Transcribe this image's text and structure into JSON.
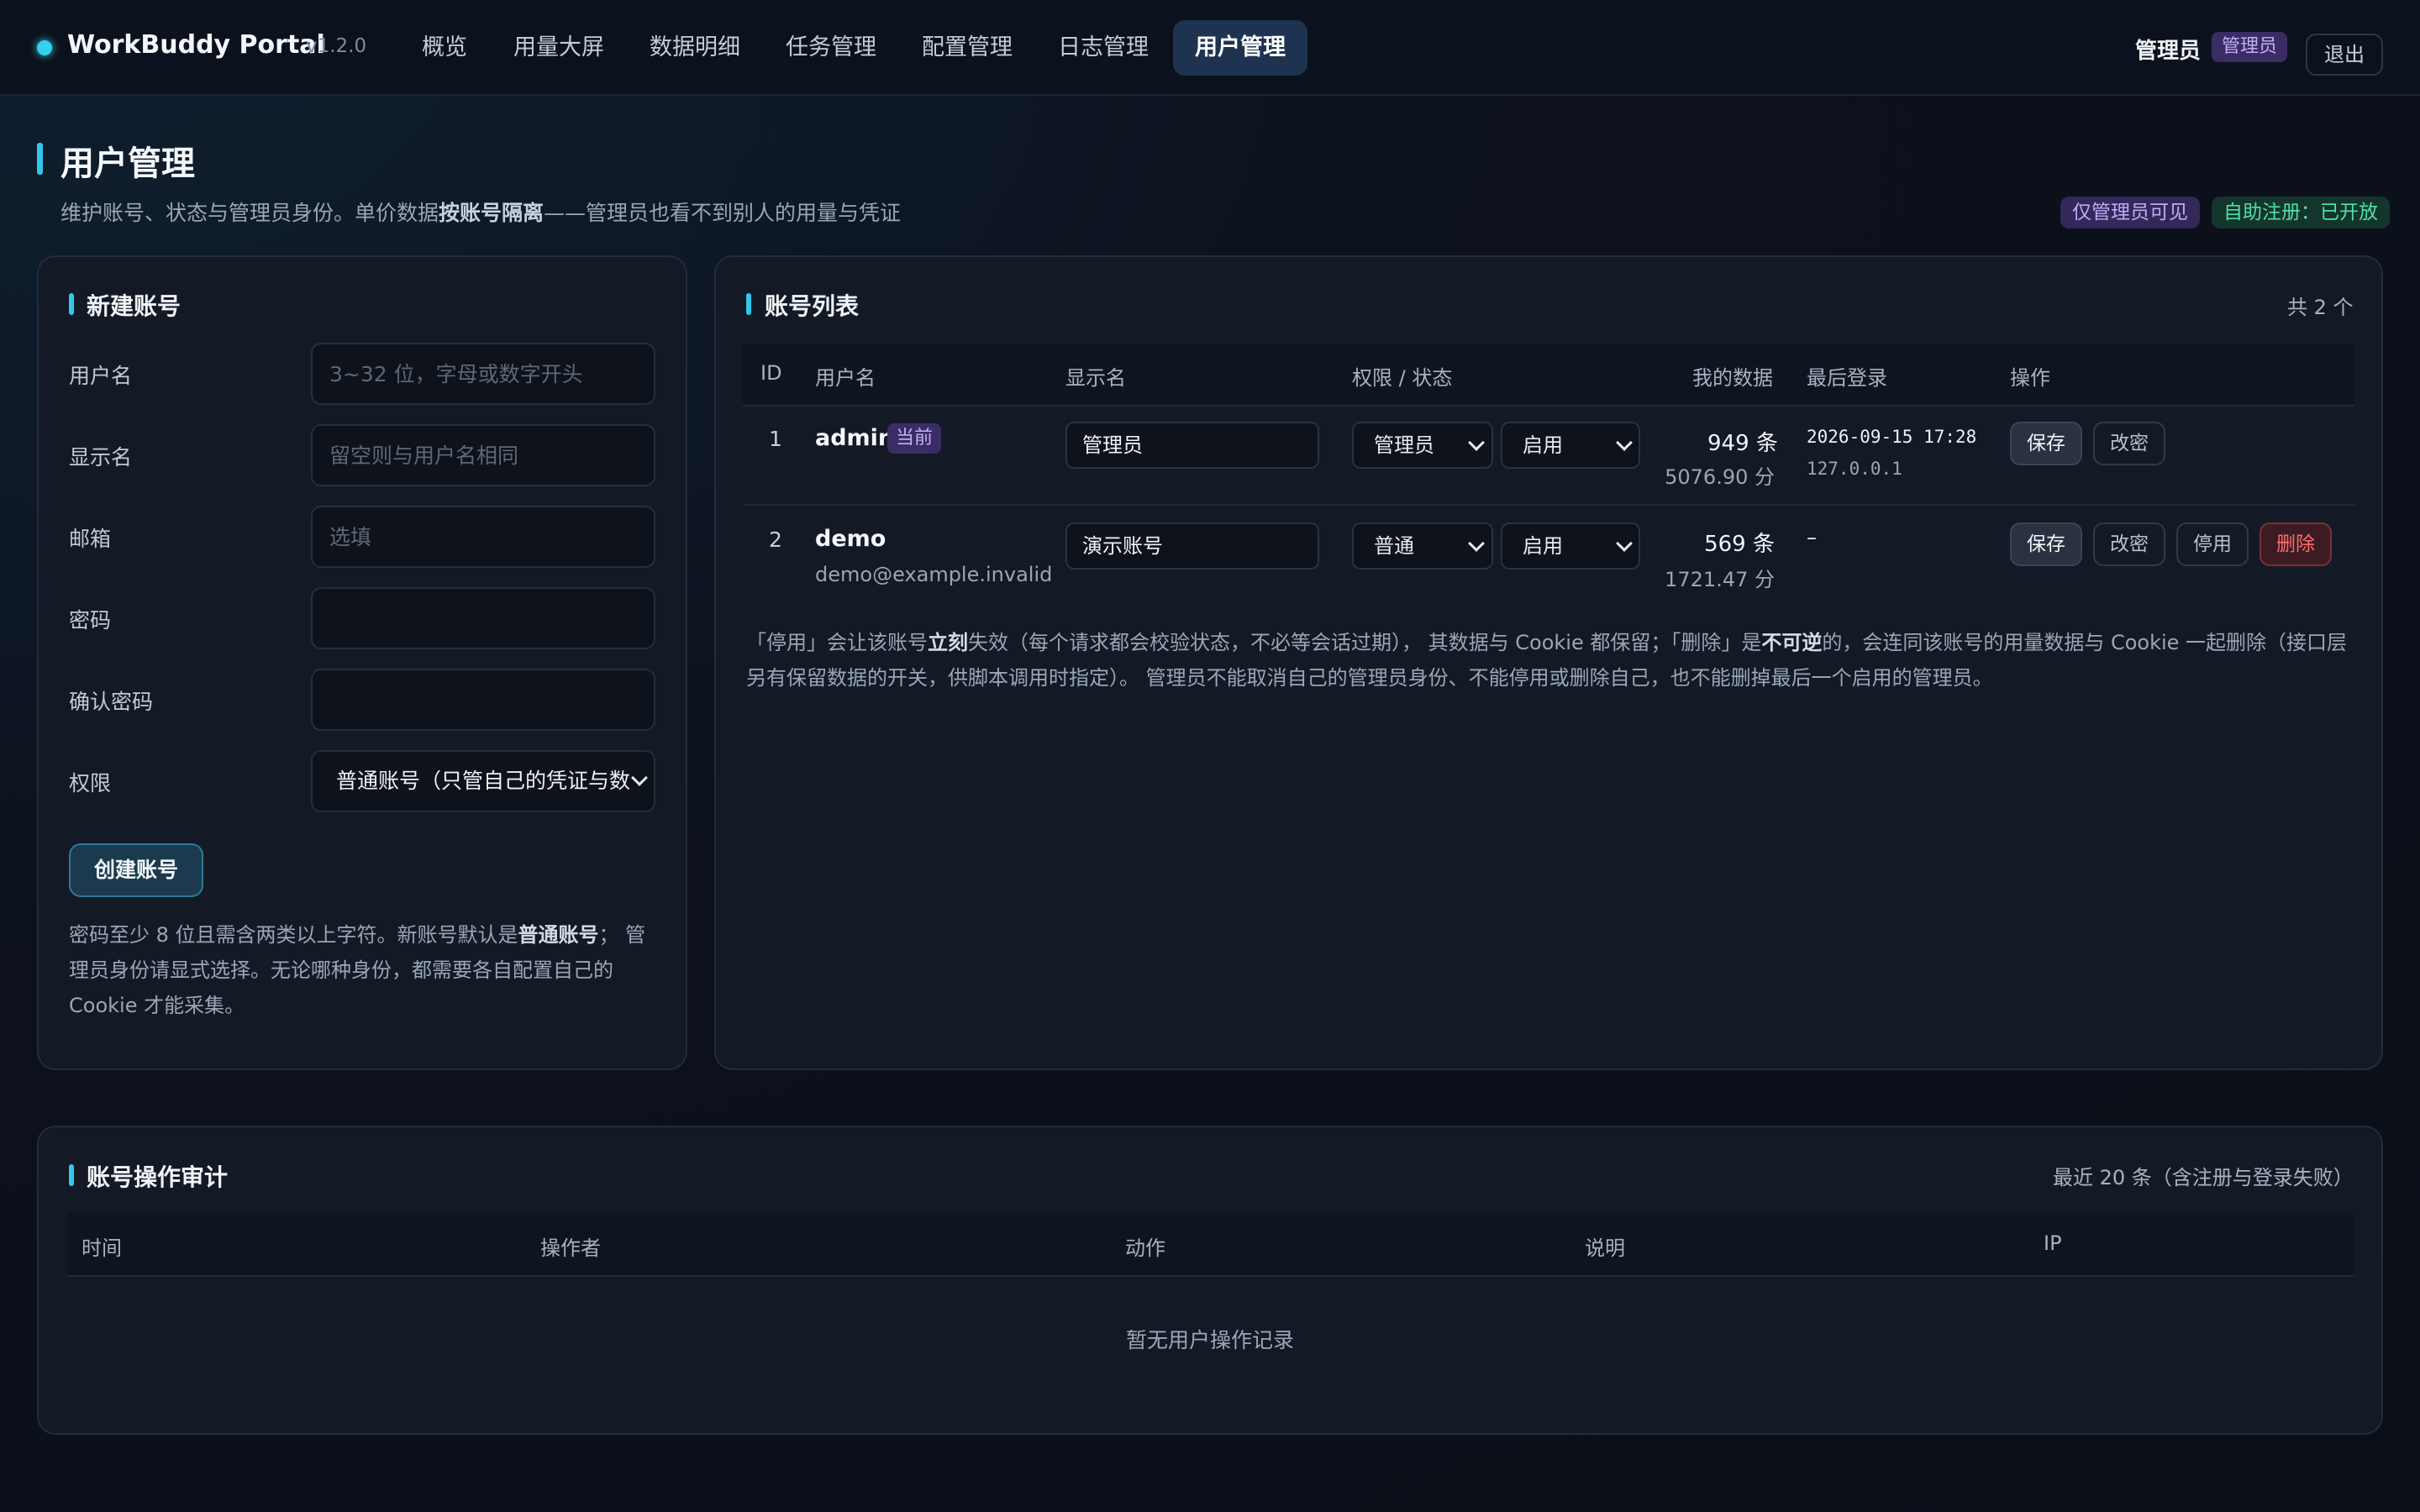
{
  "nav": {
    "brand": "WorkBuddy Portal",
    "version": "v1.2.0",
    "items": [
      "概览",
      "用量大屏",
      "数据明细",
      "任务管理",
      "配置管理",
      "日志管理",
      "用户管理"
    ],
    "active": "用户管理",
    "user_name": "管理员",
    "role_badge": "管理员",
    "logout": "退出"
  },
  "header": {
    "title": "用户管理",
    "subtitle_pre": "维护账号、状态与管理员身份。单价数据",
    "subtitle_bold": "按账号隔离",
    "subtitle_post": "——管理员也看不到别人的用量与凭证",
    "pill_admin_only": "仅管理员可见",
    "pill_self_register": "自助注册：已开放"
  },
  "create_form": {
    "title": "新建账号",
    "fields": [
      {
        "label": "用户名",
        "placeholder": "3~32 位，字母或数字开头",
        "value": ""
      },
      {
        "label": "显示名",
        "placeholder": "留空则与用户名相同",
        "value": ""
      },
      {
        "label": "邮箱",
        "placeholder": "选填",
        "value": ""
      },
      {
        "label": "密码",
        "placeholder": "",
        "value": ""
      },
      {
        "label": "确认密码",
        "placeholder": "",
        "value": ""
      }
    ],
    "role_label": "权限",
    "role_value": "普通账号（只管自己的凭证与数",
    "submit": "创建账号",
    "note_1": "密码至少 8 位且需含两类以上字符。新账号默认是",
    "note_bold": "普通账号",
    "note_2": "；  管理员身份请显式选择。无论哪种身份，都需要各自配置自己的 Cookie 才能采集。"
  },
  "account_list": {
    "title": "账号列表",
    "count": "共 2 个",
    "columns": [
      "ID",
      "用户名",
      "显示名",
      "权限 / 状态",
      "我的数据",
      "最后登录",
      "操作"
    ],
    "rows": [
      {
        "id": "1",
        "username": "admin",
        "badge": "当前",
        "email": "",
        "display_name": "管理员",
        "role": "管理员",
        "status": "启用",
        "records": "949 条",
        "score": "5076.90 分",
        "last_login": "2026-09-15 17:28",
        "ip": "127.0.0.1",
        "actions": [
          "保存",
          "改密"
        ]
      },
      {
        "id": "2",
        "username": "demo",
        "badge": "",
        "email": "demo@example.invalid",
        "display_name": "演示账号",
        "role": "普通",
        "status": "启用",
        "records": "569 条",
        "score": "1721.47 分",
        "last_login": "–",
        "ip": "",
        "actions": [
          "保存",
          "改密",
          "停用",
          "删除"
        ]
      }
    ],
    "note_p1": "「停用」会让该账号",
    "note_b1": "立刻",
    "note_p2": "失效（每个请求都会校验状态，不必等会话过期），  其数据与 Cookie 都保留；「删除」是",
    "note_b2": "不可逆",
    "note_p3": "的，会连同该账号的用量数据与 Cookie 一起删除（接口层另有保留数据的开关，供脚本调用时指定）。  管理员不能取消自己的管理员身份、不能停用或删除自己，也不能删掉最后一个启用的管理员。"
  },
  "audit": {
    "title": "账号操作审计",
    "meta": "最近 20 条（含注册与登录失败）",
    "columns": [
      "时间",
      "操作者",
      "动作",
      "说明",
      "IP"
    ],
    "empty": "暂无用户操作记录"
  },
  "colors": {
    "accent": "#33c7ea",
    "danger": "#ff6b6b",
    "success": "#4fe0a6",
    "badge": "#c5aef5"
  }
}
